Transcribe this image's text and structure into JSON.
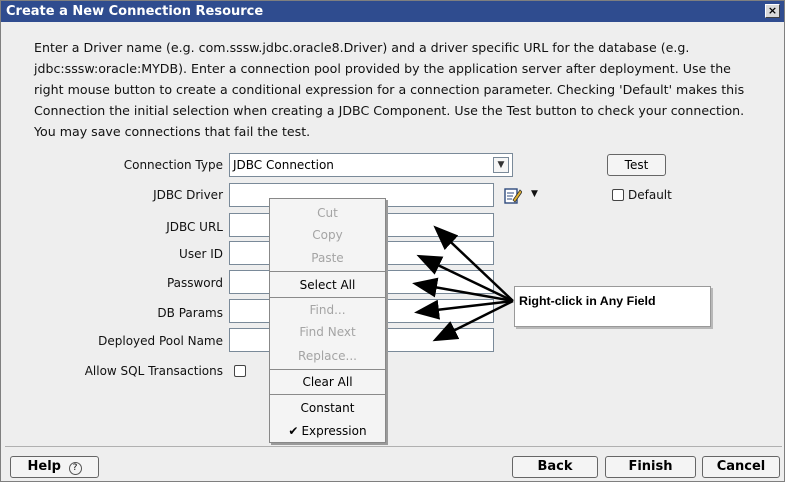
{
  "window": {
    "title": "Create a New Connection Resource",
    "close_label": "×"
  },
  "description": "Enter a Driver name (e.g. com.sssw.jdbc.oracle8.Driver) and a driver specific URL for the database (e.g. jdbc:sssw:oracle:MYDB). Enter a connection pool provided by the application server after deployment. Use the right mouse button to create a conditional expression for a connection parameter. Checking 'Default' makes this Connection the initial selection when creating a JDBC Component. Use the Test button to check your connection. You may save connections that fail the test.",
  "form": {
    "connection_type_label": "Connection Type",
    "connection_type_value": "JDBC Connection",
    "jdbc_driver_label": "JDBC Driver",
    "jdbc_url_label": "JDBC URL",
    "user_id_label": "User ID",
    "password_label": "Password",
    "db_params_label": "DB Params",
    "deployed_pool_label": "Deployed Pool Name",
    "allow_sql_label": "Allow SQL Transactions",
    "test_label": "Test",
    "default_label": "Default",
    "default_checked": false,
    "allow_sql_checked": false
  },
  "context_menu": {
    "items": [
      {
        "label": "Cut",
        "enabled": false
      },
      {
        "label": "Copy",
        "enabled": false
      },
      {
        "label": "Paste",
        "enabled": false
      },
      {
        "label": "Select All",
        "enabled": true
      },
      {
        "label": "Find...",
        "enabled": false
      },
      {
        "label": "Find Next",
        "enabled": false
      },
      {
        "label": "Replace...",
        "enabled": false
      },
      {
        "label": "Clear All",
        "enabled": true
      },
      {
        "label": "Constant",
        "enabled": true
      },
      {
        "label": "Expression",
        "enabled": true,
        "checked": true
      }
    ],
    "check_glyph": "✔"
  },
  "callout": {
    "text": "Right-click in Any Field"
  },
  "footer": {
    "help_label": "Help",
    "help_glyph": "?",
    "back_label": "Back",
    "finish_label": "Finish",
    "cancel_label": "Cancel"
  },
  "colors": {
    "titlebar": "#2f4c8f",
    "dialog_bg": "#eeeeee",
    "arrow": "#000000"
  },
  "icons": [
    "close-icon",
    "dropdown-chevron-icon",
    "edit-pencil-icon",
    "help-icon",
    "checkmark-icon"
  ]
}
